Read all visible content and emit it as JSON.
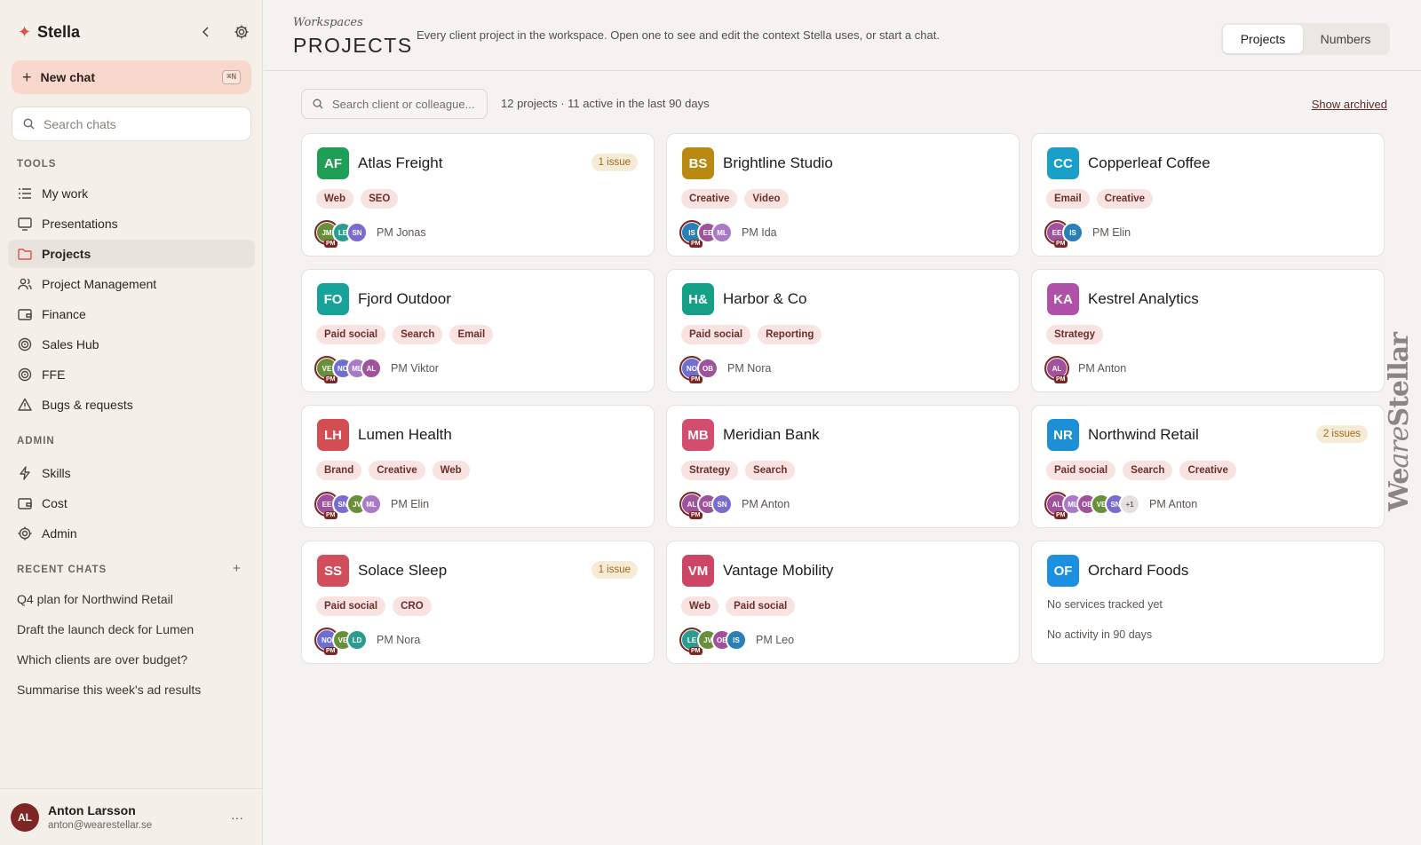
{
  "sidebar": {
    "brand": "Stella",
    "new_chat": {
      "label": "New chat",
      "shortcut": "⌘N"
    },
    "search": {
      "placeholder": "Search chats"
    },
    "tools_label": "TOOLS",
    "tools": [
      {
        "label": "My work",
        "icon": "list-icon"
      },
      {
        "label": "Presentations",
        "icon": "monitor-icon"
      },
      {
        "label": "Projects",
        "icon": "folder-icon",
        "active": true
      },
      {
        "label": "Project Management",
        "icon": "users-icon"
      },
      {
        "label": "Finance",
        "icon": "wallet-icon"
      },
      {
        "label": "Sales Hub",
        "icon": "target-icon"
      },
      {
        "label": "FFE",
        "icon": "target-icon"
      },
      {
        "label": "Bugs & requests",
        "icon": "warning-icon"
      }
    ],
    "admin_label": "ADMIN",
    "admin": [
      {
        "label": "Skills",
        "icon": "bolt-icon"
      },
      {
        "label": "Cost",
        "icon": "wallet-icon"
      },
      {
        "label": "Admin",
        "icon": "gear-icon"
      }
    ],
    "recent_label": "RECENT CHATS",
    "recent": [
      "Q4 plan for Northwind Retail",
      "Draft the launch deck for Lumen",
      "Which clients are over budget?",
      "Summarise this week's ad results"
    ],
    "user": {
      "initials": "AL",
      "name": "Anton Larsson",
      "email": "anton@wearestellar.se",
      "more": "···"
    }
  },
  "header": {
    "breadcrumb": "Workspaces",
    "title": "PROJECTS",
    "description": "Every client project in the workspace. Open one to see and edit the context Stella uses, or start a chat.",
    "tabs": [
      "Projects",
      "Numbers"
    ],
    "active_tab": "Projects"
  },
  "toolbar": {
    "search_placeholder": "Search client or colleague...",
    "count": "12 projects · 11 active in the last 90 days",
    "show_archived": "Show archived"
  },
  "projects": [
    {
      "initials": "AF",
      "name": "Atlas Freight",
      "color": "#1e9e57",
      "issue": "1 issue",
      "tags": [
        "Web",
        "SEO"
      ],
      "avatars": [
        [
          "JM",
          "#6a8f3a"
        ],
        [
          "LE",
          "#2a9d8f"
        ],
        [
          "SN",
          "#7a6ccf"
        ]
      ],
      "pm": "PM Jonas"
    },
    {
      "initials": "BS",
      "name": "Brightline Studio",
      "color": "#b88a12",
      "issue": "",
      "tags": [
        "Creative",
        "Video"
      ],
      "avatars": [
        [
          "IS",
          "#2a7fb8"
        ],
        [
          "EE",
          "#a0529c"
        ],
        [
          "ML",
          "#a87ac8"
        ]
      ],
      "pm": "PM Ida"
    },
    {
      "initials": "CC",
      "name": "Copperleaf Coffee",
      "color": "#1aa0c8",
      "issue": "",
      "tags": [
        "Email",
        "Creative"
      ],
      "avatars": [
        [
          "EE",
          "#a0529c"
        ],
        [
          "IS",
          "#2a7fb8"
        ]
      ],
      "pm": "PM Elin"
    },
    {
      "initials": "FO",
      "name": "Fjord Outdoor",
      "color": "#17a29a",
      "issue": "",
      "tags": [
        "Paid social",
        "Search",
        "Email"
      ],
      "avatars": [
        [
          "VE",
          "#6a8f3a"
        ],
        [
          "NO",
          "#6f6fd0"
        ],
        [
          "ML",
          "#a87ac8"
        ],
        [
          "AL",
          "#a0529c"
        ]
      ],
      "pm": "PM Viktor"
    },
    {
      "initials": "H&",
      "name": "Harbor & Co",
      "color": "#14a086",
      "issue": "",
      "tags": [
        "Paid social",
        "Reporting"
      ],
      "avatars": [
        [
          "NO",
          "#6f6fd0"
        ],
        [
          "OB",
          "#a0529c"
        ]
      ],
      "pm": "PM Nora"
    },
    {
      "initials": "KA",
      "name": "Kestrel Analytics",
      "color": "#b050a8",
      "issue": "",
      "tags": [
        "Strategy"
      ],
      "avatars": [
        [
          "AL",
          "#a0529c"
        ]
      ],
      "pm": "PM Anton"
    },
    {
      "initials": "LH",
      "name": "Lumen Health",
      "color": "#d34e52",
      "issue": "",
      "tags": [
        "Brand",
        "Creative",
        "Web"
      ],
      "avatars": [
        [
          "EE",
          "#a0529c"
        ],
        [
          "SN",
          "#7a6ccf"
        ],
        [
          "JV",
          "#6a8f3a"
        ],
        [
          "ML",
          "#a87ac8"
        ]
      ],
      "pm": "PM Elin"
    },
    {
      "initials": "MB",
      "name": "Meridian Bank",
      "color": "#d34e6e",
      "issue": "",
      "tags": [
        "Strategy",
        "Search"
      ],
      "avatars": [
        [
          "AL",
          "#a0529c"
        ],
        [
          "OB",
          "#a0529c"
        ],
        [
          "SN",
          "#7a6ccf"
        ]
      ],
      "pm": "PM Anton"
    },
    {
      "initials": "NR",
      "name": "Northwind Retail",
      "color": "#1d8fd6",
      "issue": "2 issues",
      "tags": [
        "Paid social",
        "Search",
        "Creative"
      ],
      "avatars": [
        [
          "AL",
          "#a0529c"
        ],
        [
          "ML",
          "#a87ac8"
        ],
        [
          "OB",
          "#a0529c"
        ],
        [
          "VE",
          "#6a8f3a"
        ],
        [
          "SN",
          "#7a6ccf"
        ],
        [
          "+1",
          "more"
        ]
      ],
      "pm": "PM Anton"
    },
    {
      "initials": "SS",
      "name": "Solace Sleep",
      "color": "#d34e5c",
      "issue": "1 issue",
      "tags": [
        "Paid social",
        "CRO"
      ],
      "avatars": [
        [
          "NO",
          "#6f6fd0"
        ],
        [
          "VE",
          "#6a8f3a"
        ],
        [
          "LD",
          "#2a9d8f"
        ]
      ],
      "pm": "PM Nora"
    },
    {
      "initials": "VM",
      "name": "Vantage Mobility",
      "color": "#cc4466",
      "issue": "",
      "tags": [
        "Web",
        "Paid social"
      ],
      "avatars": [
        [
          "LE",
          "#2a9d8f"
        ],
        [
          "JV",
          "#6a8f3a"
        ],
        [
          "OB",
          "#a0529c"
        ],
        [
          "IS",
          "#2a7fb8"
        ]
      ],
      "pm": "PM Leo"
    },
    {
      "initials": "OF",
      "name": "Orchard Foods",
      "color": "#1d8fe0",
      "issue": "",
      "tags": [],
      "avatars": [],
      "pm": "",
      "empty_services": "No services tracked yet",
      "empty_activity": "No activity in 90 days"
    }
  ],
  "pm_badge": "PM",
  "watermark": {
    "text_a": "We",
    "text_b": "are",
    "text_c": "Stellar"
  }
}
